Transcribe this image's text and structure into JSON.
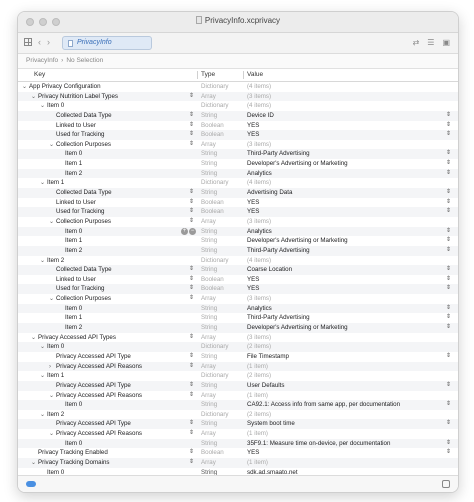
{
  "window": {
    "title": "PrivacyInfo.xcprivacy"
  },
  "toolbar": {
    "tab_label": "PrivacyInfo",
    "nav_back": "‹",
    "nav_forward": "›"
  },
  "breadcrumb": {
    "file": "PrivacyInfo",
    "selection": "No Selection"
  },
  "columns": {
    "key": "Key",
    "type": "Type",
    "value": "Value"
  },
  "rows": [
    {
      "key": "App Privacy Configuration",
      "type": "Dictionary",
      "value": "(4 items)",
      "indent": 0,
      "disc": "v"
    },
    {
      "key": "Privacy Nutrition Label Types",
      "type": "Array",
      "value": "(3 items)",
      "indent": 1,
      "disc": "v",
      "kstep": true
    },
    {
      "key": "Item 0",
      "type": "Dictionary",
      "value": "(4 items)",
      "indent": 2,
      "disc": "v"
    },
    {
      "key": "Collected Data Type",
      "type": "String",
      "value": "Device ID",
      "indent": 3,
      "kstep": true,
      "vstep": true
    },
    {
      "key": "Linked to User",
      "type": "Boolean",
      "value": "YES",
      "indent": 3,
      "kstep": true,
      "vstep": true
    },
    {
      "key": "Used for Tracking",
      "type": "Boolean",
      "value": "YES",
      "indent": 3,
      "kstep": true,
      "vstep": true
    },
    {
      "key": "Collection Purposes",
      "type": "Array",
      "value": "(3 items)",
      "indent": 3,
      "disc": "v",
      "kstep": true
    },
    {
      "key": "Item 0",
      "type": "String",
      "value": "Third-Party Advertising",
      "indent": 4,
      "vstep": true
    },
    {
      "key": "Item 1",
      "type": "String",
      "value": "Developer's Advertising or Marketing",
      "indent": 4,
      "vstep": true
    },
    {
      "key": "Item 2",
      "type": "String",
      "value": "Analytics",
      "indent": 4,
      "vstep": true
    },
    {
      "key": "Item 1",
      "type": "Dictionary",
      "value": "(4 items)",
      "indent": 2,
      "disc": "v"
    },
    {
      "key": "Collected Data Type",
      "type": "String",
      "value": "Advertising Data",
      "indent": 3,
      "kstep": true,
      "vstep": true
    },
    {
      "key": "Linked to User",
      "type": "Boolean",
      "value": "YES",
      "indent": 3,
      "kstep": true,
      "vstep": true
    },
    {
      "key": "Used for Tracking",
      "type": "Boolean",
      "value": "YES",
      "indent": 3,
      "kstep": true,
      "vstep": true
    },
    {
      "key": "Collection Purposes",
      "type": "Array",
      "value": "(3 items)",
      "indent": 3,
      "disc": "v",
      "kstep": true
    },
    {
      "key": "Item 0",
      "type": "String",
      "value": "Analytics",
      "indent": 4,
      "vstep": true,
      "pm": true
    },
    {
      "key": "Item 1",
      "type": "String",
      "value": "Developer's Advertising or Marketing",
      "indent": 4,
      "vstep": true
    },
    {
      "key": "Item 2",
      "type": "String",
      "value": "Third-Party Advertising",
      "indent": 4,
      "vstep": true
    },
    {
      "key": "Item 2",
      "type": "Dictionary",
      "value": "(4 items)",
      "indent": 2,
      "disc": "v"
    },
    {
      "key": "Collected Data Type",
      "type": "String",
      "value": "Coarse Location",
      "indent": 3,
      "kstep": true,
      "vstep": true
    },
    {
      "key": "Linked to User",
      "type": "Boolean",
      "value": "YES",
      "indent": 3,
      "kstep": true,
      "vstep": true
    },
    {
      "key": "Used for Tracking",
      "type": "Boolean",
      "value": "YES",
      "indent": 3,
      "kstep": true,
      "vstep": true
    },
    {
      "key": "Collection Purposes",
      "type": "Array",
      "value": "(3 items)",
      "indent": 3,
      "disc": "v",
      "kstep": true
    },
    {
      "key": "Item 0",
      "type": "String",
      "value": "Analytics",
      "indent": 4,
      "vstep": true
    },
    {
      "key": "Item 1",
      "type": "String",
      "value": "Third-Party Advertising",
      "indent": 4,
      "vstep": true
    },
    {
      "key": "Item 2",
      "type": "String",
      "value": "Developer's Advertising or Marketing",
      "indent": 4,
      "vstep": true
    },
    {
      "key": "Privacy Accessed API Types",
      "type": "Array",
      "value": "(3 items)",
      "indent": 1,
      "disc": "v",
      "kstep": true
    },
    {
      "key": "Item 0",
      "type": "Dictionary",
      "value": "(2 items)",
      "indent": 2,
      "disc": "v"
    },
    {
      "key": "Privacy Accessed API Type",
      "type": "String",
      "value": "File Timestamp",
      "indent": 3,
      "kstep": true,
      "vstep": true
    },
    {
      "key": "Privacy Accessed API Reasons",
      "type": "Array",
      "value": "(1 item)",
      "indent": 3,
      "disc": ">",
      "kstep": true
    },
    {
      "key": "Item 1",
      "type": "Dictionary",
      "value": "(2 items)",
      "indent": 2,
      "disc": "v"
    },
    {
      "key": "Privacy Accessed API Type",
      "type": "String",
      "value": "User Defaults",
      "indent": 3,
      "kstep": true,
      "vstep": true
    },
    {
      "key": "Privacy Accessed API Reasons",
      "type": "Array",
      "value": "(1 item)",
      "indent": 3,
      "disc": "v",
      "kstep": true
    },
    {
      "key": "Item 0",
      "type": "String",
      "value": "CA92.1: Access info from same app, per documentation",
      "indent": 4,
      "vstep": true
    },
    {
      "key": "Item 2",
      "type": "Dictionary",
      "value": "(2 items)",
      "indent": 2,
      "disc": "v"
    },
    {
      "key": "Privacy Accessed API Type",
      "type": "String",
      "value": "System boot time",
      "indent": 3,
      "kstep": true,
      "vstep": true
    },
    {
      "key": "Privacy Accessed API Reasons",
      "type": "Array",
      "value": "(1 item)",
      "indent": 3,
      "disc": "v",
      "kstep": true
    },
    {
      "key": "Item 0",
      "type": "String",
      "value": "35F9.1: Measure time on-device, per documentation",
      "indent": 4,
      "vstep": true
    },
    {
      "key": "Privacy Tracking Enabled",
      "type": "Boolean",
      "value": "YES",
      "indent": 1,
      "kstep": true,
      "vstep": true
    },
    {
      "key": "Privacy Tracking Domains",
      "type": "Array",
      "value": "(1 item)",
      "indent": 1,
      "disc": "v",
      "kstep": true
    },
    {
      "key": "Item 0",
      "type": "String",
      "value": "sdk.ad.smaato.net",
      "indent": 2,
      "dark": true
    }
  ]
}
